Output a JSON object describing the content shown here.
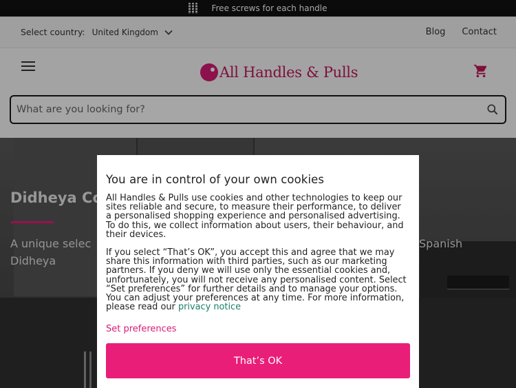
{
  "promo": {
    "text": "Free screws for each handle",
    "icon": "screws-icon"
  },
  "country_bar": {
    "label": "Select country:",
    "selected_country": "United Kingdom",
    "links": [
      "Blog",
      "Contact"
    ]
  },
  "header": {
    "logo_text": "All Handles & Pulls",
    "search_placeholder": "What are you looking for?",
    "icons": {
      "menu": "hamburger-menu-icon",
      "cart": "shopping-cart-icon",
      "search": "search-icon"
    }
  },
  "hero": {
    "title": "Didheya Co",
    "description_start": "A unique selec",
    "description_end": "Spanish",
    "description_line2": "Didheya"
  },
  "cookie_modal": {
    "title": "You are in control of your own cookies",
    "paragraph1": "All Handles & Pulls use cookies and other technologies to keep our sites reliable and secure, to measure their performance, to deliver a personalised shopping experience and personalised advertising. To do this, we collect information about users, their behaviour, and their devices.",
    "paragraph2": "If you select “That’s OK”, you accept this and agree that we may share this information with third parties, such as our marketing partners. If you deny we will use only the essential cookies and, unfortunately, you will not receive any personalised content. Select “Set preferences” for further details and to manage your options. You can adjust your preferences at any time. For more information, please read our",
    "privacy_link": "privacy notice",
    "set_preferences": "Set preferences",
    "accept_button": "That’s OK"
  },
  "colors": {
    "brand": "#e91e79",
    "promo_bg": "#111111",
    "link_green": "#1a7f64"
  }
}
